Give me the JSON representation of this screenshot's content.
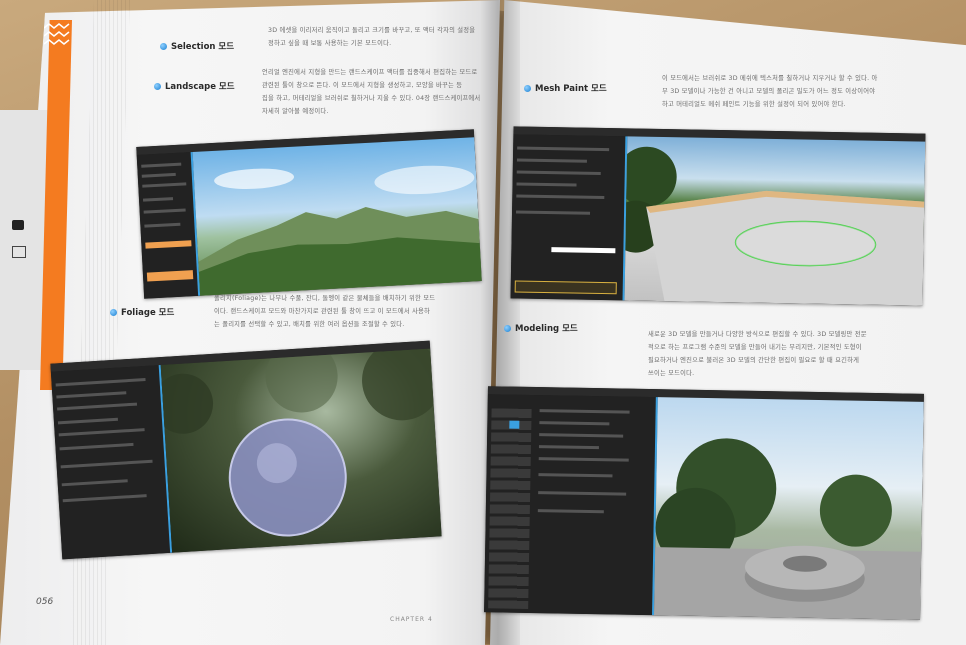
{
  "left_page": {
    "page_number": "056",
    "chapter_label": "CHAPTER 4",
    "sections": [
      {
        "heading": "Selection 모드",
        "lines": [
          "3D 에셋을 이리저리 움직이고 돌리고 크기를 바꾸고, 또 액터 각자의 설정을",
          "정하고 싶을 때 보통 사용하는 기본 모드이다."
        ]
      },
      {
        "heading": "Landscape 모드",
        "lines": [
          "언리얼 엔진에서 지형을 만드는 랜드스케이프 액터를 집중해서 편집하는 모드로",
          "관련된 툴이 창으로 뜬다. 이 모드에서 지형을 생성하고, 모양을 바꾸는 등",
          "집을 하고, 머테리얼을 브러쉬로 칠하거나 지울 수 있다. 04장 랜드스케이프에서",
          "자세히 알아볼 예정이다."
        ]
      },
      {
        "heading": "Foliage 모드",
        "lines": [
          "폴리지(Foliage)는 나무나 수풀, 잔디, 돌멩이 같은 물체들을 배치하기 위한 모드",
          "이다. 랜드스케이프 모드와 마찬가지로 관련된 툴 창이 뜨고 이 모드에서 사용하",
          "는 폴리지를 선택할 수 있고, 배치를 위한 여러 옵션들 조절할 수 있다."
        ]
      }
    ]
  },
  "right_page": {
    "sections": [
      {
        "heading": "Mesh Paint 모드",
        "lines": [
          "이 모드에서는 브러쉬로 3D 메쉬에 텍스처를 칠하거나 지우거나 할 수 있다. 아",
          "무 3D 모델이나 가능한 건 아니고 모델의 폴리곤 밀도가 어느 정도 이상이어야",
          "하고 머테리얼도 메쉬 페인트 기능을 위한 설정이 되어 있어야 한다."
        ]
      },
      {
        "heading": "Modeling 모드",
        "lines": [
          "새로운 3D 모델을 만들거나 다양한 방식으로 편집할 수 있다. 3D 모델링만 전문",
          "적으로 하는 프로그램 수준의 모델을 만들어 내기는 무리지만, 기본적인 도형이",
          "필요하거나 엔진으로 불러온 3D 모델의 간단한 편집이 필요로 할 때 요긴하게",
          "쓰이는 모드이다."
        ]
      }
    ]
  },
  "colors": {
    "accent_orange": "#f47b20",
    "accent_blue": "#3aa0e0"
  }
}
